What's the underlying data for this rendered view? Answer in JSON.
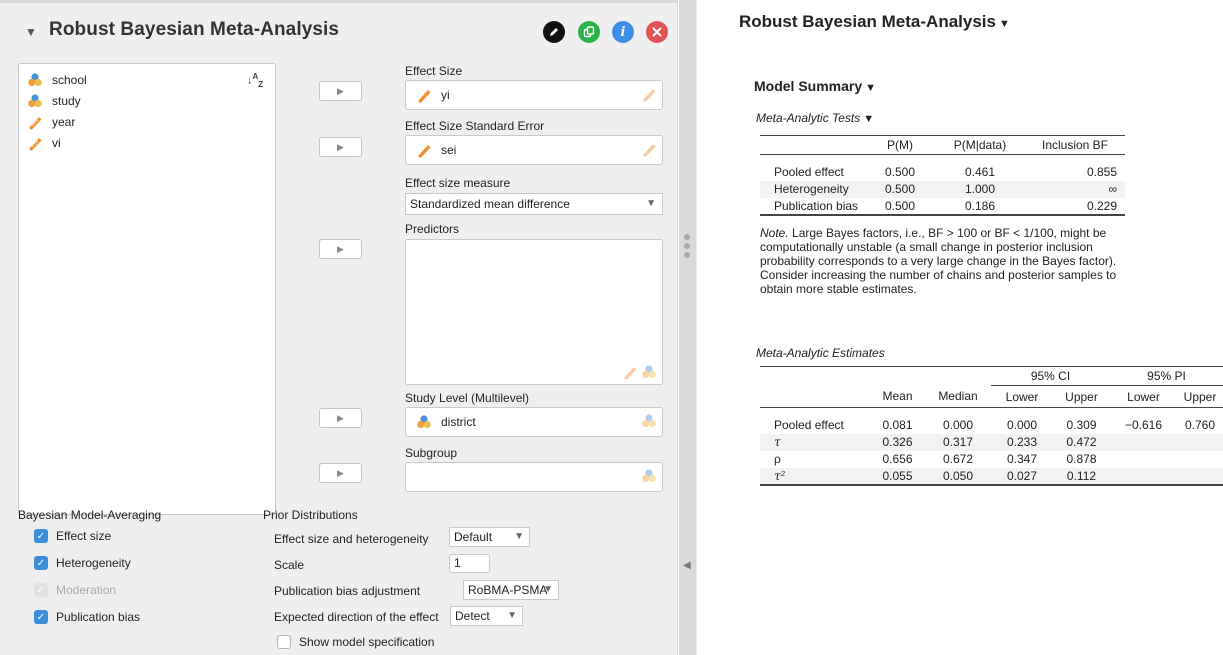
{
  "panel": {
    "title": "Robust Bayesian Meta-Analysis",
    "variables": [
      "school",
      "study",
      "year",
      "vi"
    ],
    "sort_icon": "↓A Z",
    "fields": {
      "effect_size": {
        "label": "Effect Size",
        "value": "yi"
      },
      "effect_size_se": {
        "label": "Effect Size Standard Error",
        "value": "sei"
      },
      "effect_size_measure": {
        "label": "Effect size measure",
        "value": "Standardized mean difference"
      },
      "predictors": {
        "label": "Predictors"
      },
      "study_level": {
        "label": "Study Level (Multilevel)",
        "value": "district"
      },
      "subgroup": {
        "label": "Subgroup"
      }
    },
    "bma": {
      "title": "Bayesian Model-Averaging",
      "effect_size": "Effect size",
      "heterogeneity": "Heterogeneity",
      "moderation": "Moderation",
      "publication_bias": "Publication bias"
    },
    "priors": {
      "title": "Prior Distributions",
      "effect_het_label": "Effect size and heterogeneity",
      "effect_het_value": "Default",
      "scale_label": "Scale",
      "scale_value": "1",
      "pub_bias_label": "Publication bias adjustment",
      "pub_bias_value": "RoBMA-PSMA",
      "direction_label": "Expected direction of the effect",
      "direction_value": "Detect",
      "show_spec_label": "Show model specification"
    }
  },
  "results": {
    "title": "Robust Bayesian Meta-Analysis",
    "model_summary": "Model Summary",
    "tests": {
      "title": "Meta-Analytic Tests",
      "headers": [
        "",
        "P(M)",
        "P(M|data)",
        "Inclusion BF"
      ],
      "rows": [
        [
          "Pooled effect",
          "0.500",
          "0.461",
          "0.855"
        ],
        [
          "Heterogeneity",
          "0.500",
          "1.000",
          "∞"
        ],
        [
          "Publication bias",
          "0.500",
          "0.186",
          "0.229"
        ]
      ],
      "note_label": "Note.",
      "note_text": " Large Bayes factors, i.e., BF > 100 or BF < 1/100, might be computationally unstable (a small change in posterior inclusion probability corresponds to a very large change in the Bayes factor). Consider increasing the number of chains and posterior samples to obtain more stable estimates."
    },
    "estimates": {
      "title": "Meta-Analytic Estimates",
      "ci_group": "95% CI",
      "pi_group": "95% PI",
      "headers": [
        "",
        "Mean",
        "Median",
        "Lower",
        "Upper",
        "Lower",
        "Upper"
      ],
      "rows": [
        [
          "Pooled effect",
          "0.081",
          "0.000",
          "0.000",
          "0.309",
          "−0.616",
          "0.760"
        ],
        [
          "τ",
          "0.326",
          "0.317",
          "0.233",
          "0.472",
          "",
          ""
        ],
        [
          "ρ",
          "0.656",
          "0.672",
          "0.347",
          "0.878",
          "",
          ""
        ],
        [
          "τ²",
          "0.055",
          "0.050",
          "0.027",
          "0.112",
          "",
          ""
        ]
      ]
    }
  }
}
